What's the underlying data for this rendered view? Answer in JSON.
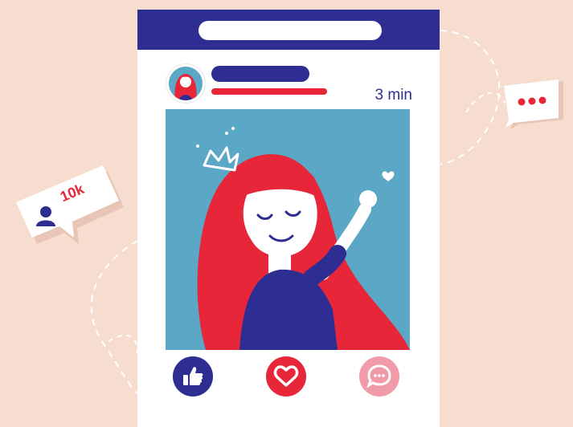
{
  "post": {
    "time": "3 min"
  },
  "actions": [
    {
      "icon": "thumbs-up-icon",
      "color": "#2e2e92"
    },
    {
      "icon": "heart-icon",
      "color": "#e8263a"
    },
    {
      "icon": "speech-bubble-icon",
      "color": "#f19aa8"
    }
  ],
  "notifications": {
    "likes_count": "10k",
    "typing_indicator": "..."
  },
  "colors": {
    "background": "#f6ddcf",
    "navy": "#2e2e92",
    "red": "#e8263a",
    "sky": "#5ba7c6",
    "pink": "#f19aa8"
  }
}
